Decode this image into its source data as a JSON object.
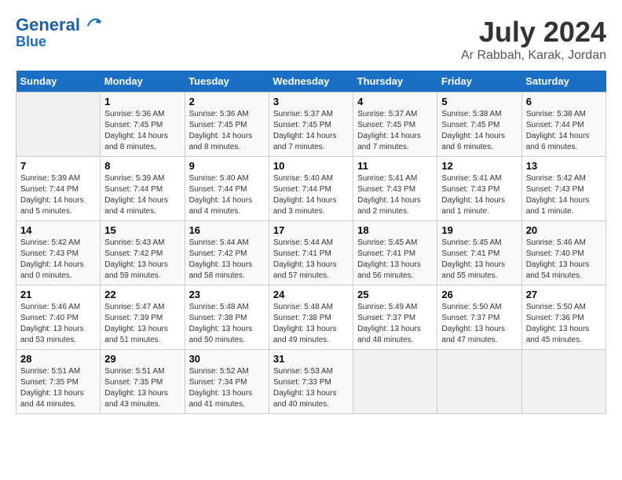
{
  "header": {
    "logo_line1": "General",
    "logo_line2": "Blue",
    "month": "July 2024",
    "location": "Ar Rabbah, Karak, Jordan"
  },
  "weekdays": [
    "Sunday",
    "Monday",
    "Tuesday",
    "Wednesday",
    "Thursday",
    "Friday",
    "Saturday"
  ],
  "weeks": [
    [
      {
        "day": "",
        "info": ""
      },
      {
        "day": "1",
        "info": "Sunrise: 5:36 AM\nSunset: 7:45 PM\nDaylight: 14 hours\nand 8 minutes."
      },
      {
        "day": "2",
        "info": "Sunrise: 5:36 AM\nSunset: 7:45 PM\nDaylight: 14 hours\nand 8 minutes."
      },
      {
        "day": "3",
        "info": "Sunrise: 5:37 AM\nSunset: 7:45 PM\nDaylight: 14 hours\nand 7 minutes."
      },
      {
        "day": "4",
        "info": "Sunrise: 5:37 AM\nSunset: 7:45 PM\nDaylight: 14 hours\nand 7 minutes."
      },
      {
        "day": "5",
        "info": "Sunrise: 5:38 AM\nSunset: 7:45 PM\nDaylight: 14 hours\nand 6 minutes."
      },
      {
        "day": "6",
        "info": "Sunrise: 5:38 AM\nSunset: 7:44 PM\nDaylight: 14 hours\nand 6 minutes."
      }
    ],
    [
      {
        "day": "7",
        "info": "Sunrise: 5:39 AM\nSunset: 7:44 PM\nDaylight: 14 hours\nand 5 minutes."
      },
      {
        "day": "8",
        "info": "Sunrise: 5:39 AM\nSunset: 7:44 PM\nDaylight: 14 hours\nand 4 minutes."
      },
      {
        "day": "9",
        "info": "Sunrise: 5:40 AM\nSunset: 7:44 PM\nDaylight: 14 hours\nand 4 minutes."
      },
      {
        "day": "10",
        "info": "Sunrise: 5:40 AM\nSunset: 7:44 PM\nDaylight: 14 hours\nand 3 minutes."
      },
      {
        "day": "11",
        "info": "Sunrise: 5:41 AM\nSunset: 7:43 PM\nDaylight: 14 hours\nand 2 minutes."
      },
      {
        "day": "12",
        "info": "Sunrise: 5:41 AM\nSunset: 7:43 PM\nDaylight: 14 hours\nand 1 minute."
      },
      {
        "day": "13",
        "info": "Sunrise: 5:42 AM\nSunset: 7:43 PM\nDaylight: 14 hours\nand 1 minute."
      }
    ],
    [
      {
        "day": "14",
        "info": "Sunrise: 5:42 AM\nSunset: 7:43 PM\nDaylight: 14 hours\nand 0 minutes."
      },
      {
        "day": "15",
        "info": "Sunrise: 5:43 AM\nSunset: 7:42 PM\nDaylight: 13 hours\nand 59 minutes."
      },
      {
        "day": "16",
        "info": "Sunrise: 5:44 AM\nSunset: 7:42 PM\nDaylight: 13 hours\nand 58 minutes."
      },
      {
        "day": "17",
        "info": "Sunrise: 5:44 AM\nSunset: 7:41 PM\nDaylight: 13 hours\nand 57 minutes."
      },
      {
        "day": "18",
        "info": "Sunrise: 5:45 AM\nSunset: 7:41 PM\nDaylight: 13 hours\nand 56 minutes."
      },
      {
        "day": "19",
        "info": "Sunrise: 5:45 AM\nSunset: 7:41 PM\nDaylight: 13 hours\nand 55 minutes."
      },
      {
        "day": "20",
        "info": "Sunrise: 5:46 AM\nSunset: 7:40 PM\nDaylight: 13 hours\nand 54 minutes."
      }
    ],
    [
      {
        "day": "21",
        "info": "Sunrise: 5:46 AM\nSunset: 7:40 PM\nDaylight: 13 hours\nand 53 minutes."
      },
      {
        "day": "22",
        "info": "Sunrise: 5:47 AM\nSunset: 7:39 PM\nDaylight: 13 hours\nand 51 minutes."
      },
      {
        "day": "23",
        "info": "Sunrise: 5:48 AM\nSunset: 7:38 PM\nDaylight: 13 hours\nand 50 minutes."
      },
      {
        "day": "24",
        "info": "Sunrise: 5:48 AM\nSunset: 7:38 PM\nDaylight: 13 hours\nand 49 minutes."
      },
      {
        "day": "25",
        "info": "Sunrise: 5:49 AM\nSunset: 7:37 PM\nDaylight: 13 hours\nand 48 minutes."
      },
      {
        "day": "26",
        "info": "Sunrise: 5:50 AM\nSunset: 7:37 PM\nDaylight: 13 hours\nand 47 minutes."
      },
      {
        "day": "27",
        "info": "Sunrise: 5:50 AM\nSunset: 7:36 PM\nDaylight: 13 hours\nand 45 minutes."
      }
    ],
    [
      {
        "day": "28",
        "info": "Sunrise: 5:51 AM\nSunset: 7:35 PM\nDaylight: 13 hours\nand 44 minutes."
      },
      {
        "day": "29",
        "info": "Sunrise: 5:51 AM\nSunset: 7:35 PM\nDaylight: 13 hours\nand 43 minutes."
      },
      {
        "day": "30",
        "info": "Sunrise: 5:52 AM\nSunset: 7:34 PM\nDaylight: 13 hours\nand 41 minutes."
      },
      {
        "day": "31",
        "info": "Sunrise: 5:53 AM\nSunset: 7:33 PM\nDaylight: 13 hours\nand 40 minutes."
      },
      {
        "day": "",
        "info": ""
      },
      {
        "day": "",
        "info": ""
      },
      {
        "day": "",
        "info": ""
      }
    ]
  ]
}
